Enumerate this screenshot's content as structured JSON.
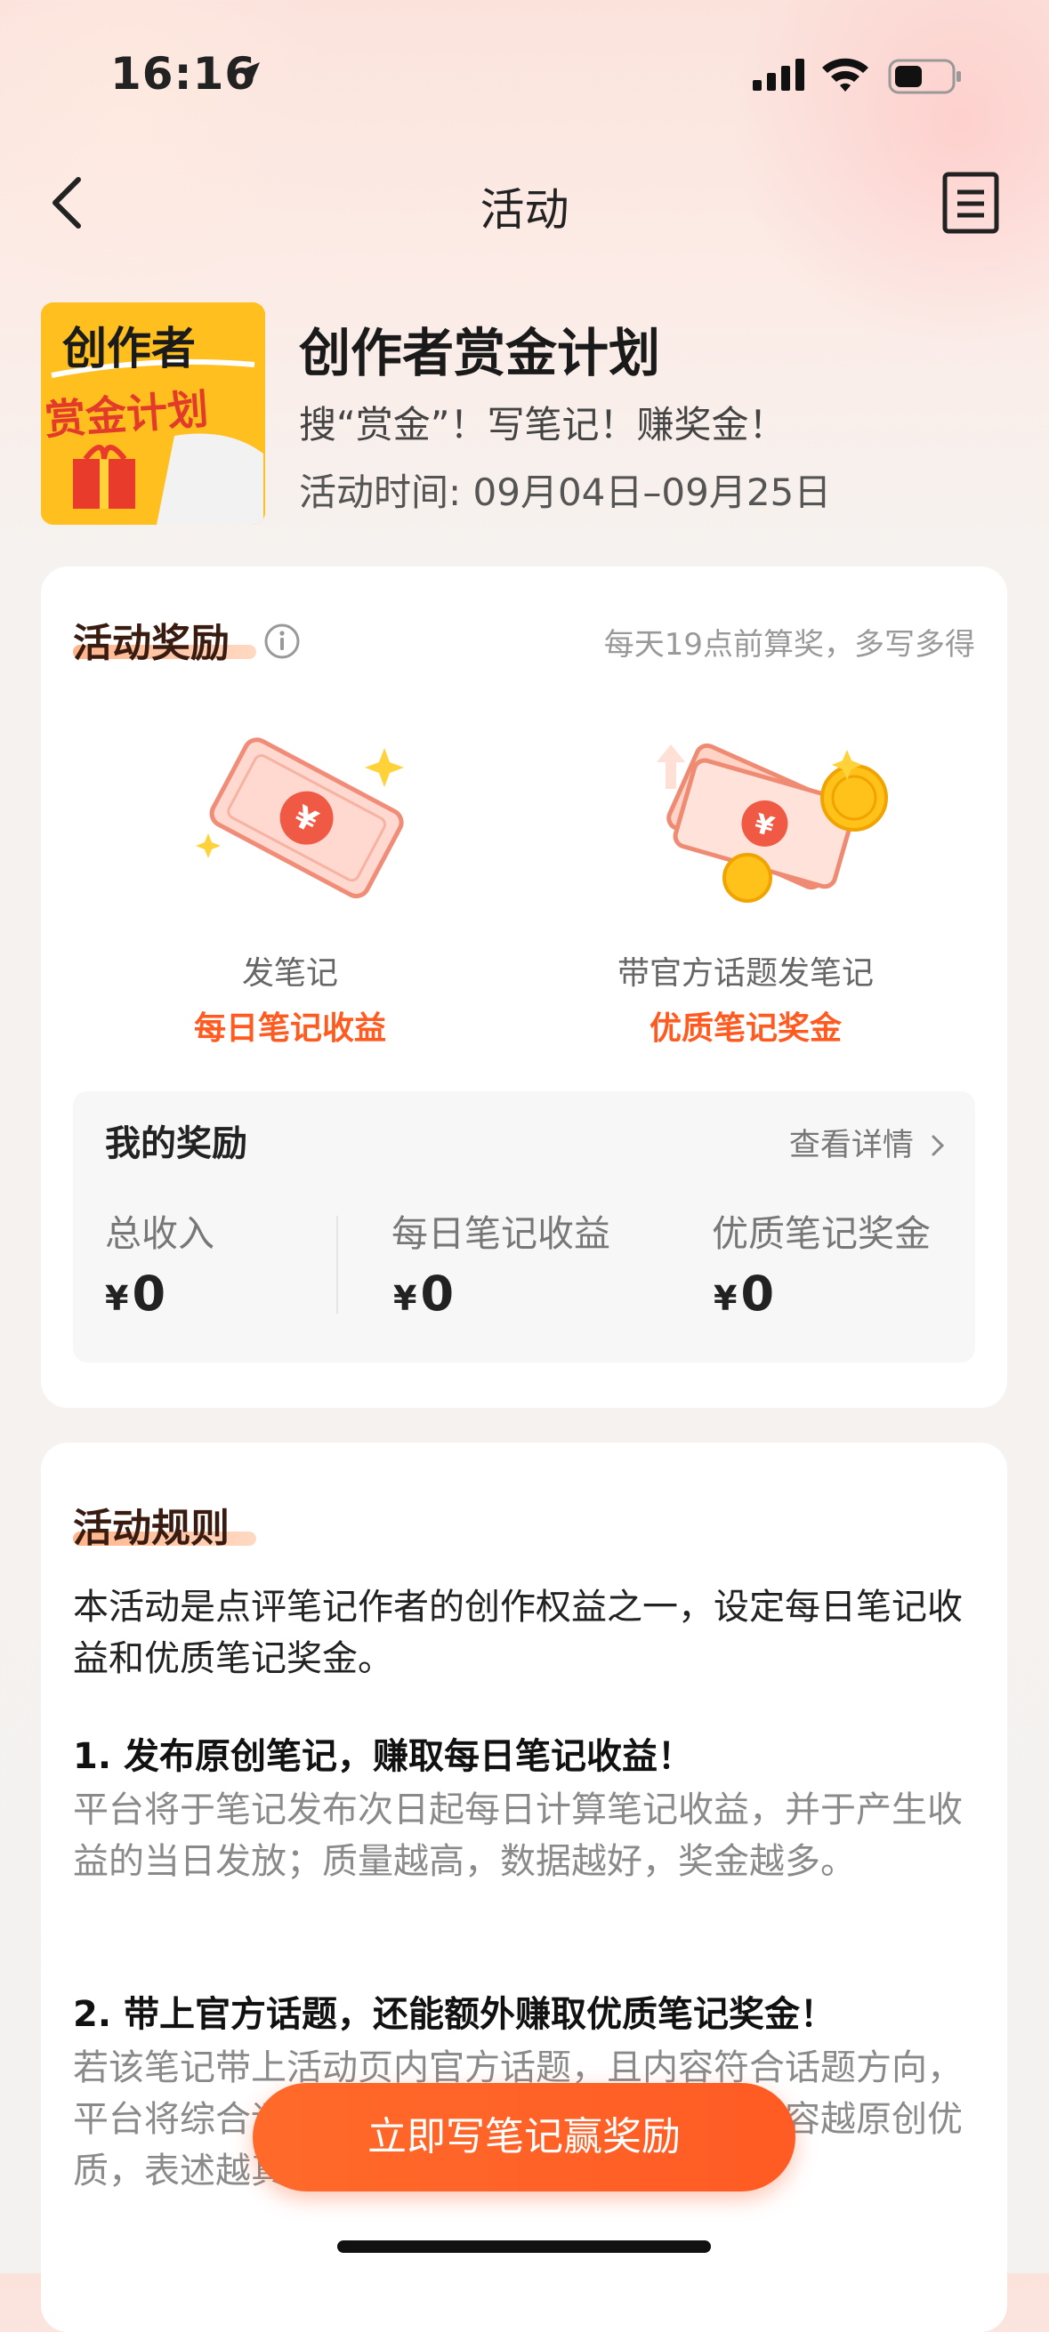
{
  "status_bar": {
    "time": "16:16"
  },
  "nav": {
    "title": "活动"
  },
  "header": {
    "cover_text_line1": "创作者",
    "cover_text_line2": "赏金计划",
    "title": "创作者赏金计划",
    "subtitle": "搜“赏金”！写笔记！赚奖金！",
    "time": "活动时间: 09月04日–09月25日"
  },
  "rewards": {
    "section_title": "活动奖励",
    "tip": "每天19点前算奖，多写多得",
    "items": [
      {
        "label": "发笔记",
        "name": "每日笔记收益"
      },
      {
        "label": "带官方话题发笔记",
        "name": "优质笔记奖金"
      }
    ],
    "mine": {
      "title": "我的奖励",
      "detail_link": "查看详情",
      "currency": "¥",
      "stats": [
        {
          "label": "总收入",
          "value": "0"
        },
        {
          "label": "每日笔记收益",
          "value": "0"
        },
        {
          "label": "优质笔记奖金",
          "value": "0"
        }
      ]
    }
  },
  "rules": {
    "section_title": "活动规则",
    "intro": "本活动是点评笔记作者的创作权益之一，设定每日笔记收益和优质笔记奖金。",
    "items": [
      {
        "heading": "1. 发布原创笔记，赚取每日笔记收益！",
        "body": "平台将于笔记发布次日起每日计算笔记收益，并于产生收益的当日发放；质量越高，数据越好，奖金越多。"
      },
      {
        "heading": "2. 带上官方话题，还能额外赚取优质笔记奖金！",
        "body": "若该笔记带上活动页内官方话题，且内容符合话题方向，平台将综合评估笔记优质度，并发放奖金；内容越原创优质，表述越真实，越有机会获奖。"
      }
    ]
  },
  "cta": {
    "label": "立即写笔记赢奖励"
  },
  "colors": {
    "accent": "#ff5a1f",
    "brand_dark": "#3a1b10"
  }
}
